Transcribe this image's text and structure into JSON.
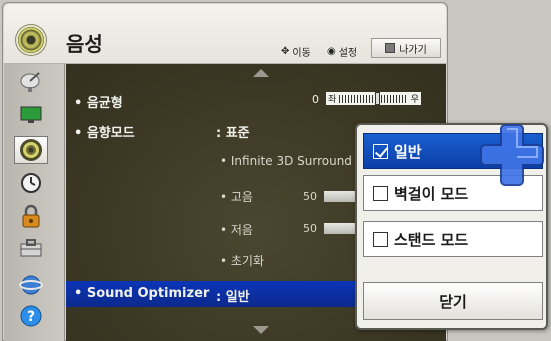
{
  "header": {
    "title": "음성",
    "hint_move": "이동",
    "hint_set": "설정",
    "exit_label": "나가기"
  },
  "sidebar": {
    "items": [
      {
        "icon": "satellite-dish-icon"
      },
      {
        "icon": "monitor-icon"
      },
      {
        "icon": "speaker-icon",
        "active": true
      },
      {
        "icon": "clock-icon"
      },
      {
        "icon": "lock-icon"
      },
      {
        "icon": "toolbox-icon"
      },
      {
        "icon": "network-globe-icon"
      },
      {
        "icon": "help-icon"
      }
    ]
  },
  "menu": {
    "balance_label": "• 음균형",
    "balance_value": "0",
    "balance_left": "좌",
    "balance_right": "우",
    "balance_level": 0,
    "sound_mode_label": "• 음향모드",
    "sound_mode_value": ": 표준",
    "surround_label": "• Infinite 3D Surround",
    "treble_label": "• 고음",
    "treble_value": "50",
    "bass_label": "• 저음",
    "bass_value": "50",
    "reset_label": "• 초기화",
    "optimizer_label": "• Sound Optimizer",
    "optimizer_value": ": 일반"
  },
  "popup": {
    "options": [
      {
        "label": "일반",
        "checked": true
      },
      {
        "label": "벽걸이 모드",
        "checked": false
      },
      {
        "label": "스탠드 모드",
        "checked": false
      }
    ],
    "close_label": "닫기"
  },
  "colors": {
    "highlight": "#0c2a8c",
    "selected_option": "#1a5fcf",
    "content_bg": "#3c3824",
    "cursor": "#3f74e6"
  }
}
